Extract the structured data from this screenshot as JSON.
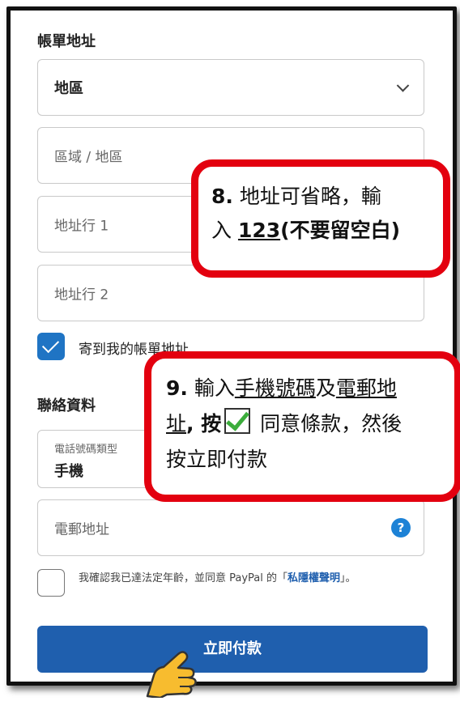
{
  "billing": {
    "section_title": "帳單地址",
    "region_value": "地區",
    "area_placeholder": "區域 / 地區",
    "address1_placeholder": "地址行 1",
    "address2_placeholder": "地址行 2",
    "ship_to_billing_label": "寄到我的帳單地址",
    "ship_to_billing_checked": true
  },
  "contact": {
    "section_title": "聯絡資料",
    "phone_type_label": "電話號碼類型",
    "phone_type_value": "手機",
    "email_placeholder": "電郵地址",
    "help_icon": "?"
  },
  "consent": {
    "text_before": "我確認我已達法定年齡，並同意 PayPal 的「",
    "link_text": "私隱權聲明",
    "text_after": "」。",
    "checked": false
  },
  "pay_button_label": "立即付款",
  "callout1": {
    "step": "8.",
    "line1_rest": " 地址可省略，輸",
    "line2_prefix": "入 ",
    "line2_value": "123",
    "line2_suffix": "(不要留空白)"
  },
  "callout2": {
    "step": "9.",
    "line1_prefix": " 輸入",
    "line1_u1": "手機號碼",
    "line1_mid": "及",
    "line1_u2": "電郵地",
    "line2_u": "址",
    "line2_after_u": ", 按",
    "line2_rest": " 同意條款，然後",
    "line3": "按立即付款"
  },
  "colors": {
    "primary": "#1f5fae",
    "callout_border": "#e3000f",
    "checkbox": "#1f74c4"
  }
}
